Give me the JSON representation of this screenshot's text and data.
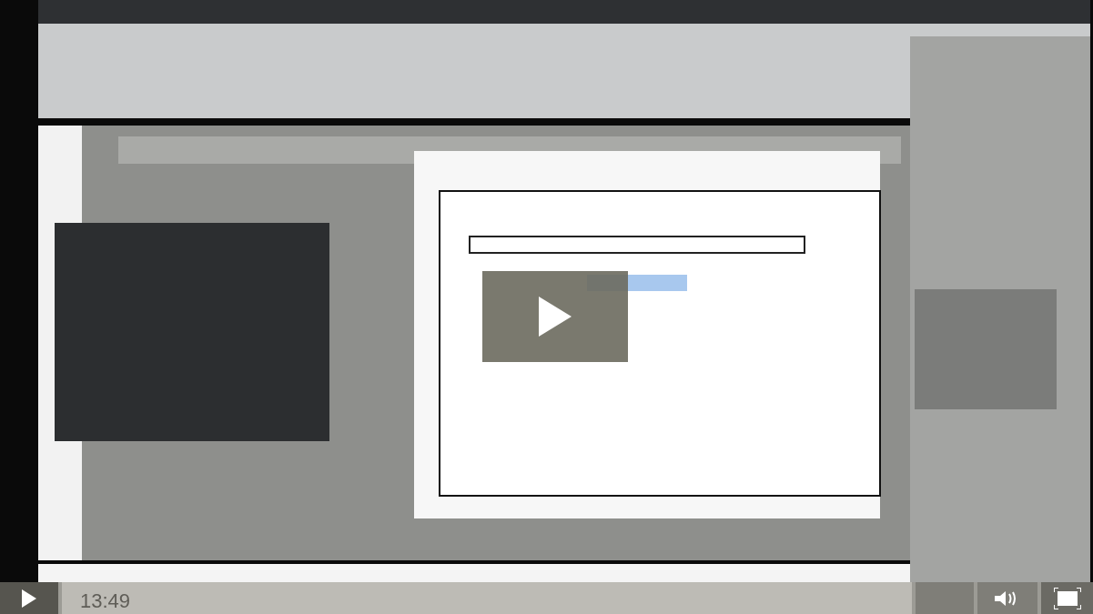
{
  "player": {
    "time": "13:49",
    "level": 1
  }
}
